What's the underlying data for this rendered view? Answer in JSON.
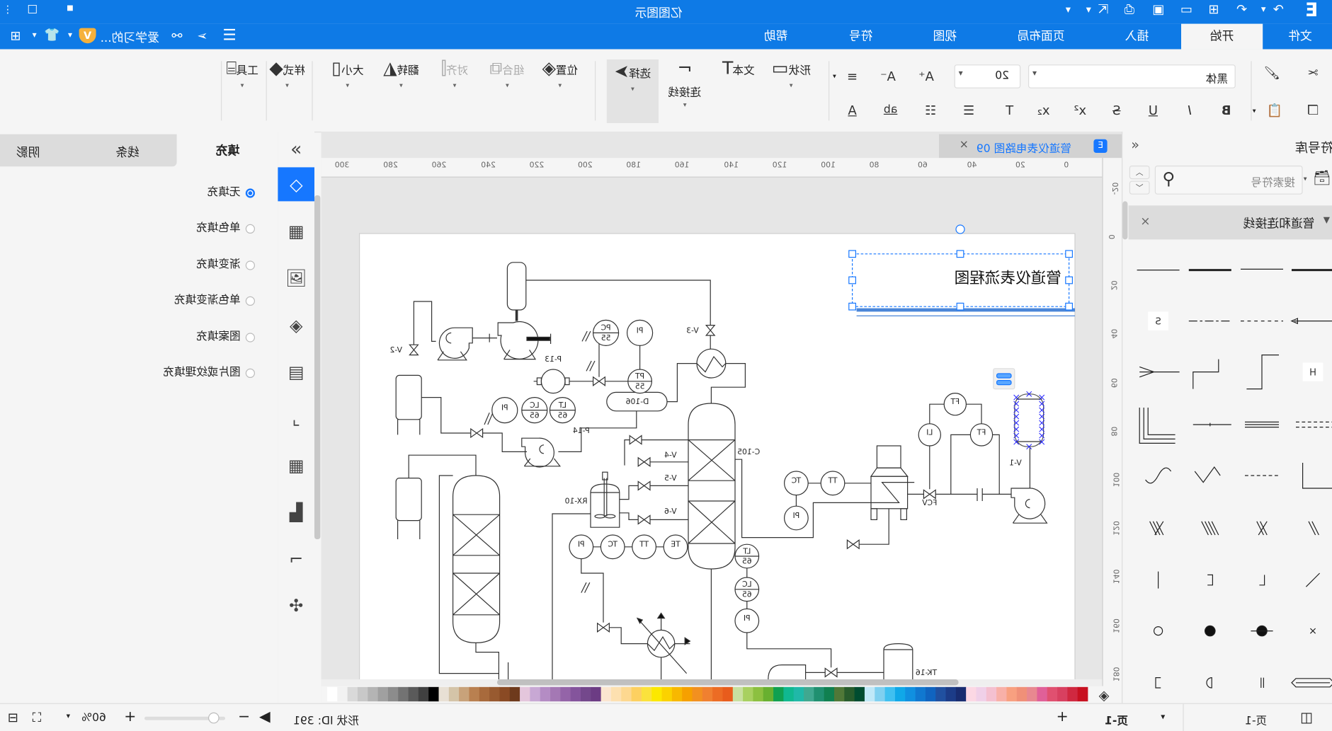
{
  "app": {
    "title": "亿图图示",
    "user": "爱学习的...",
    "accent": "#0e7ae6",
    "logo": "E"
  },
  "menu": {
    "tabs": [
      {
        "label": "文件"
      },
      {
        "label": "开始",
        "active": true
      },
      {
        "label": "插入"
      },
      {
        "label": "页面布局"
      },
      {
        "label": "视图"
      },
      {
        "label": "符号"
      },
      {
        "label": "帮助"
      }
    ]
  },
  "ribbon": {
    "font_name": "黑体",
    "font_size": "20",
    "tools": [
      {
        "label": "形状",
        "icon": "rectangle-icon"
      },
      {
        "label": "文本",
        "icon": "text-icon"
      },
      {
        "label": "连接线",
        "icon": "connector-icon"
      },
      {
        "label": "选择",
        "icon": "pointer-icon",
        "selected": true
      },
      {
        "label": "位置",
        "icon": "layers-icon"
      },
      {
        "label": "组合",
        "icon": "group-icon",
        "disabled": true
      },
      {
        "label": "对齐",
        "icon": "align-icon",
        "disabled": true
      },
      {
        "label": "翻转",
        "icon": "flip-icon"
      },
      {
        "label": "大小",
        "icon": "size-icon"
      },
      {
        "label": "样式",
        "icon": "style-icon"
      },
      {
        "label": "工具",
        "icon": "tools-icon"
      }
    ]
  },
  "fill_panel": {
    "tabs": [
      {
        "label": "填充",
        "active": true
      },
      {
        "label": "线条"
      },
      {
        "label": "阴影"
      }
    ],
    "options": [
      {
        "label": "无填充",
        "checked": true
      },
      {
        "label": "单色填充"
      },
      {
        "label": "渐变填充"
      },
      {
        "label": "单色渐变填充"
      },
      {
        "label": "图案填充"
      },
      {
        "label": "图片或纹理填充"
      }
    ]
  },
  "document": {
    "tab": "管道仪表电路图 09"
  },
  "ruler": {
    "horizontal": [
      0,
      20,
      40,
      60,
      80,
      100,
      120,
      140,
      160,
      180,
      200,
      220,
      240,
      260,
      280,
      300
    ],
    "vertical": [
      -20,
      0,
      20,
      40,
      60,
      80,
      100,
      120,
      140,
      160,
      180
    ]
  },
  "diagram": {
    "title": "管道仪表流程图",
    "labels": {
      "v2": "V-2",
      "v3": "V-3",
      "p13": "P-13",
      "d106": "D-106",
      "p14": "P-14",
      "c105": "C-105",
      "v4": "V-4",
      "v5": "V-5",
      "v6": "V-6",
      "rx10": "RX-10",
      "fcv": "FCV",
      "v1": "V-1",
      "tk16": "TK-16"
    },
    "instruments": [
      {
        "tag": "PC",
        "num": "55"
      },
      {
        "tag": "PI"
      },
      {
        "tag": "PT",
        "num": "55"
      },
      {
        "tag": "PI"
      },
      {
        "tag": "LC",
        "num": "65"
      },
      {
        "tag": "LT",
        "num": "65"
      },
      {
        "tag": "PI"
      },
      {
        "tag": "TC"
      },
      {
        "tag": "TT"
      },
      {
        "tag": "TE"
      },
      {
        "tag": "LT",
        "num": "65"
      },
      {
        "tag": "LC",
        "num": "65"
      },
      {
        "tag": "PI"
      },
      {
        "tag": "TC"
      },
      {
        "tag": "TT"
      },
      {
        "tag": "PI"
      },
      {
        "tag": "FT"
      },
      {
        "tag": "LI"
      },
      {
        "tag": "FT"
      }
    ]
  },
  "symbols": {
    "header": "符号库",
    "search_placeholder": "搜索符号",
    "category": "管道和连接线",
    "s_label": "S",
    "h_label": "H"
  },
  "status": {
    "zoom": "60%",
    "shape_id": "形状 ID: 391",
    "page_tab": "页-1",
    "page_selector": "页-1"
  },
  "palette": [
    "#ffffff",
    "#f2f2f2",
    "#d9d9d9",
    "#c8c8c8",
    "#b4b4b4",
    "#a0a0a0",
    "#8c8c8c",
    "#737373",
    "#5a5a5a",
    "#404040",
    "#000000",
    "#e8e0d4",
    "#d4c4a8",
    "#c8a27a",
    "#b98050",
    "#a86a3c",
    "#985a30",
    "#8a4a24",
    "#6e3a1c",
    "#e4c6dc",
    "#c8a8d4",
    "#b48cc4",
    "#a478b4",
    "#9464a8",
    "#84549c",
    "#74488c",
    "#6c3c84",
    "#fbe6d0",
    "#fde0b0",
    "#fdd890",
    "#fdd060",
    "#fbe23c",
    "#fce800",
    "#fbd200",
    "#f8b800",
    "#f6a000",
    "#f29020",
    "#f08030",
    "#ec6c24",
    "#e85c1c",
    "#c8e0a0",
    "#a8d060",
    "#8cc040",
    "#68b030",
    "#10a050",
    "#10b890",
    "#20b8a8",
    "#40a890",
    "#209070",
    "#108050",
    "#507838",
    "#285c2c",
    "#004c30",
    "#c0e8f8",
    "#80d0f0",
    "#40c0f0",
    "#10a8e8",
    "#1090e0",
    "#1078d0",
    "#1064c0",
    "#2050a0",
    "#1c3c88",
    "#182c70",
    "#fcd8e4",
    "#f0d0e8",
    "#f4c0d0",
    "#f8b0a8",
    "#f8a080",
    "#f09078",
    "#e88890",
    "#e06098",
    "#e05070",
    "#d84060",
    "#d02840",
    "#c81020"
  ]
}
